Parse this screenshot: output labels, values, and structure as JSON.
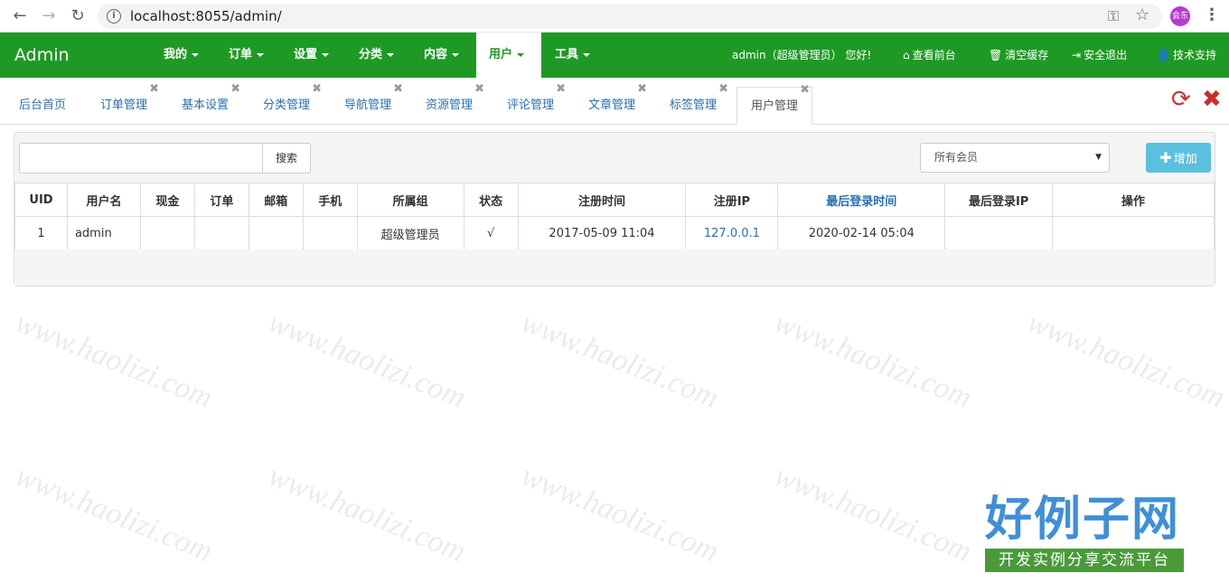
{
  "browser": {
    "url": "localhost:8055/admin/",
    "profile_label": "会东"
  },
  "navbar": {
    "brand": "Admin",
    "menu": [
      {
        "label": "我的"
      },
      {
        "label": "订单"
      },
      {
        "label": "设置"
      },
      {
        "label": "分类"
      },
      {
        "label": "内容"
      },
      {
        "label": "用户",
        "active": true
      },
      {
        "label": "工具"
      }
    ],
    "greeting": "admin（超级管理员） 您好!",
    "links": [
      {
        "label": "查看前台",
        "icon": "home-icon"
      },
      {
        "label": "清空缓存",
        "icon": "trash-icon"
      },
      {
        "label": "安全退出",
        "icon": "logout-icon"
      },
      {
        "label": "技术支持",
        "icon": "user-icon"
      }
    ]
  },
  "tabs": [
    {
      "label": "后台首页"
    },
    {
      "label": "订单管理"
    },
    {
      "label": "基本设置"
    },
    {
      "label": "分类管理"
    },
    {
      "label": "导航管理"
    },
    {
      "label": "资源管理"
    },
    {
      "label": "评论管理"
    },
    {
      "label": "文章管理"
    },
    {
      "label": "标签管理"
    },
    {
      "label": "用户管理",
      "active": true
    }
  ],
  "toolbar": {
    "search_value": "",
    "search_button": "搜索",
    "member_filter": "所有会员",
    "add_button": "增加"
  },
  "table": {
    "columns": [
      "UID",
      "用户名",
      "现金",
      "订单",
      "邮箱",
      "手机",
      "所属组",
      "状态",
      "注册时间",
      "注册IP",
      "最后登录时间",
      "最后登录IP",
      "操作"
    ],
    "rows": [
      {
        "uid": "1",
        "username": "admin",
        "cash": "",
        "orders": "",
        "email": "",
        "phone": "",
        "group": "超级管理员",
        "status": "√",
        "reg_time": "2017-05-09 11:04",
        "reg_ip": "127.0.0.1",
        "last_login_time": "2020-02-14 05:04",
        "last_login_ip": "",
        "actions": ""
      }
    ]
  },
  "watermark": {
    "text": "www.haolizi.com",
    "logo_main": "好例子网",
    "logo_sub": "开发实例分享交流平台"
  },
  "colors": {
    "navbar": "#1e9a24",
    "link": "#2b6fb4",
    "add_button": "#5bc0de",
    "danger": "#c9302c"
  }
}
